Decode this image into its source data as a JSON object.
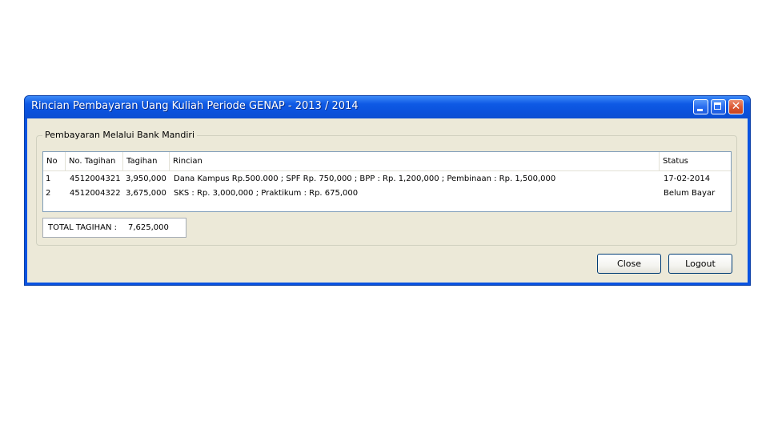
{
  "window": {
    "title": "Rincian Pembayaran Uang Kuliah Periode GENAP - 2013 / 2014",
    "controls": {
      "minimize_icon": "minimize-icon",
      "maximize_icon": "maximize-icon",
      "close_icon": "close-icon",
      "close_glyph": "✕"
    }
  },
  "group": {
    "title": "Pembayaran Melalui Bank Mandiri"
  },
  "table": {
    "columns": [
      "No",
      "No. Tagihan",
      "Tagihan",
      "Rincian",
      "Status"
    ],
    "rows": [
      [
        "1",
        "4512004321",
        "3,950,000",
        "Dana Kampus Rp.500.000 ; SPF Rp. 750,000 ; BPP : Rp. 1,200,000 ; Pembinaan : Rp. 1,500,000",
        "17-02-2014"
      ],
      [
        "2",
        "4512004322",
        "3,675,000",
        "SKS : Rp. 3,000,000 ; Praktikum : Rp. 675,000",
        "Belum Bayar"
      ]
    ]
  },
  "total": {
    "label": "TOTAL TAGIHAN :",
    "value": "7,625,000"
  },
  "buttons": {
    "close_label": "Close",
    "logout_label": "Logout"
  },
  "colors": {
    "titlebar": "#0a53e1",
    "client_background": "#ece9d8",
    "table_border": "#7f9db9",
    "button_border": "#003c74"
  }
}
